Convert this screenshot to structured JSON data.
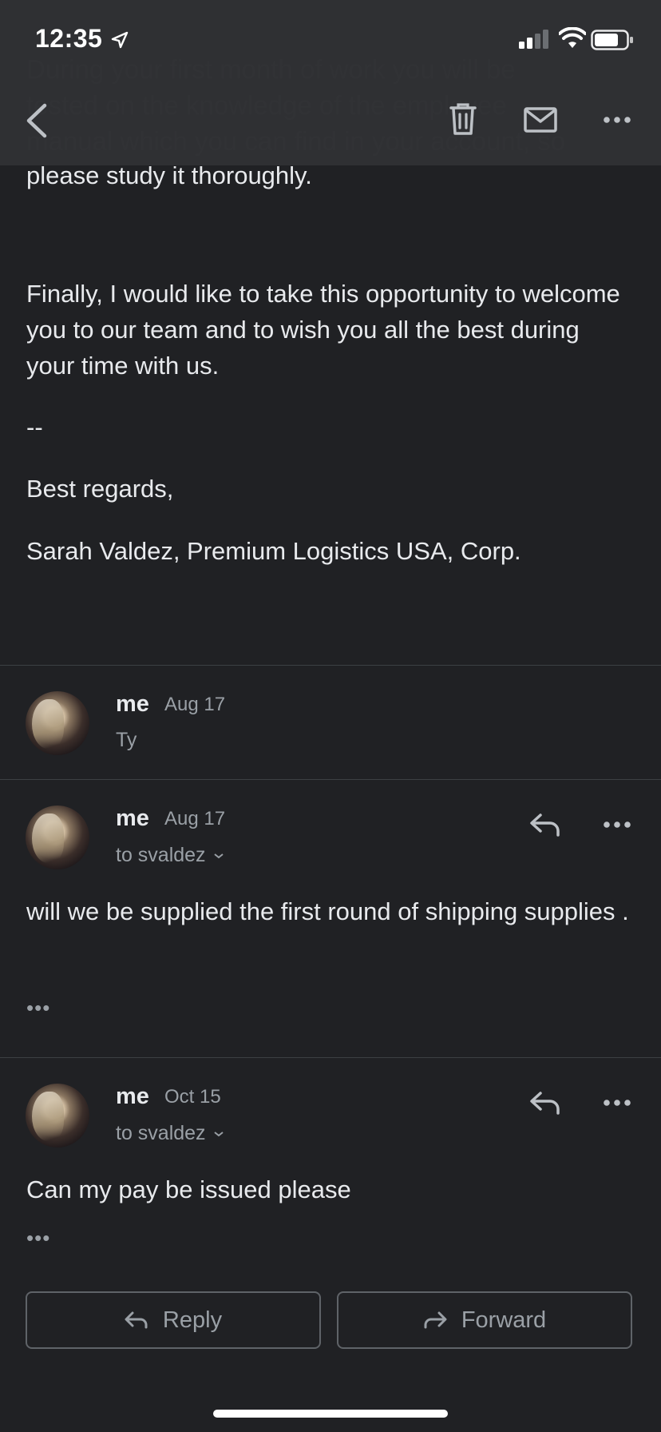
{
  "status_bar": {
    "time": "12:35"
  },
  "toolbar": {
    "back_icon": "chevron-left-icon",
    "delete_icon": "trash-icon",
    "mark_unread_icon": "mail-icon",
    "more_icon": "more-horizontal-icon"
  },
  "previous_message": {
    "faded_lines": [
      "During your first month of work you will be",
      "tested on the knowledge of the employee",
      "manual which you can find in your account, so",
      "please study it thoroughly."
    ],
    "paragraph": "Finally, I would like to take this opportunity to welcome you to our team and to wish you all the best during your time with us.",
    "separator": "--",
    "closing": "Best regards,",
    "signature": "Sarah Valdez, Premium Logistics USA, Corp."
  },
  "messages": [
    {
      "sender": "me",
      "date": "Aug 17",
      "snippet": "Ty"
    },
    {
      "sender": "me",
      "date": "Aug 17",
      "recipient": "to svaldez",
      "body": "will we be supplied the first round of shipping supplies .",
      "ellipsis": "•••"
    },
    {
      "sender": "me",
      "date": "Oct 15",
      "recipient": "to svaldez",
      "body": "Can my pay be issued please",
      "ellipsis": "•••"
    }
  ],
  "actions": {
    "reply_label": "Reply",
    "forward_label": "Forward"
  },
  "colors": {
    "background": "#202124",
    "text": "#e8eaed",
    "secondary": "#9aa0a6",
    "divider": "#3c4043"
  }
}
